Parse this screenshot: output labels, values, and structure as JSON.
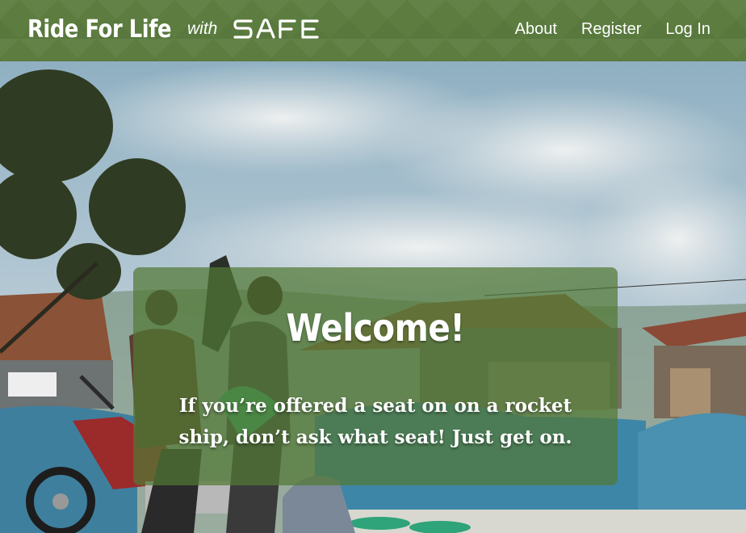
{
  "brand": {
    "title": "Ride For Life",
    "with": "with",
    "logo_text": "SAFE"
  },
  "nav": {
    "items": [
      {
        "label": "About"
      },
      {
        "label": "Register"
      },
      {
        "label": "Log In"
      }
    ]
  },
  "hero": {
    "image_name": "market-motorcycle-photo",
    "heading": "Welcome!",
    "body": "If you’re offered a seat on on a rocket ship, don’t ask what seat! Just get on."
  },
  "colors": {
    "navbar": "#5c7d3f",
    "card_overlay": "rgba(82, 120, 52, 0.72)",
    "text": "#ffffff"
  }
}
